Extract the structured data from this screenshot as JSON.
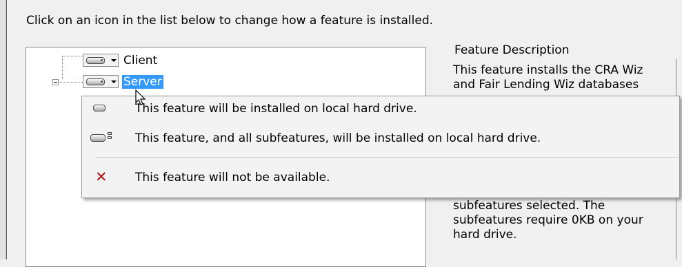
{
  "instruction": "Click on an icon in the list below to change how a feature is installed.",
  "tree": {
    "items": [
      {
        "label": "Client",
        "icon": "hard-drive-icon",
        "selected": false
      },
      {
        "label": "Server",
        "icon": "hard-drive-icon",
        "selected": true
      }
    ]
  },
  "description": {
    "title": "Feature Description",
    "body": "This feature installs the CRA Wiz\nand Fair Lending Wiz databases",
    "bottom": "subfeatures selected. The\nsubfeatures require 0KB on your\nhard drive."
  },
  "menu": {
    "items": [
      {
        "icon": "hard-drive-icon",
        "label": "This feature will be installed on local hard drive."
      },
      {
        "icon": "hard-drive-subfeatures-icon",
        "label": "This feature, and all subfeatures, will be installed on local hard drive."
      },
      {
        "icon": "red-x-icon",
        "label": "This feature will not be available.",
        "color": "#b01010"
      }
    ]
  }
}
